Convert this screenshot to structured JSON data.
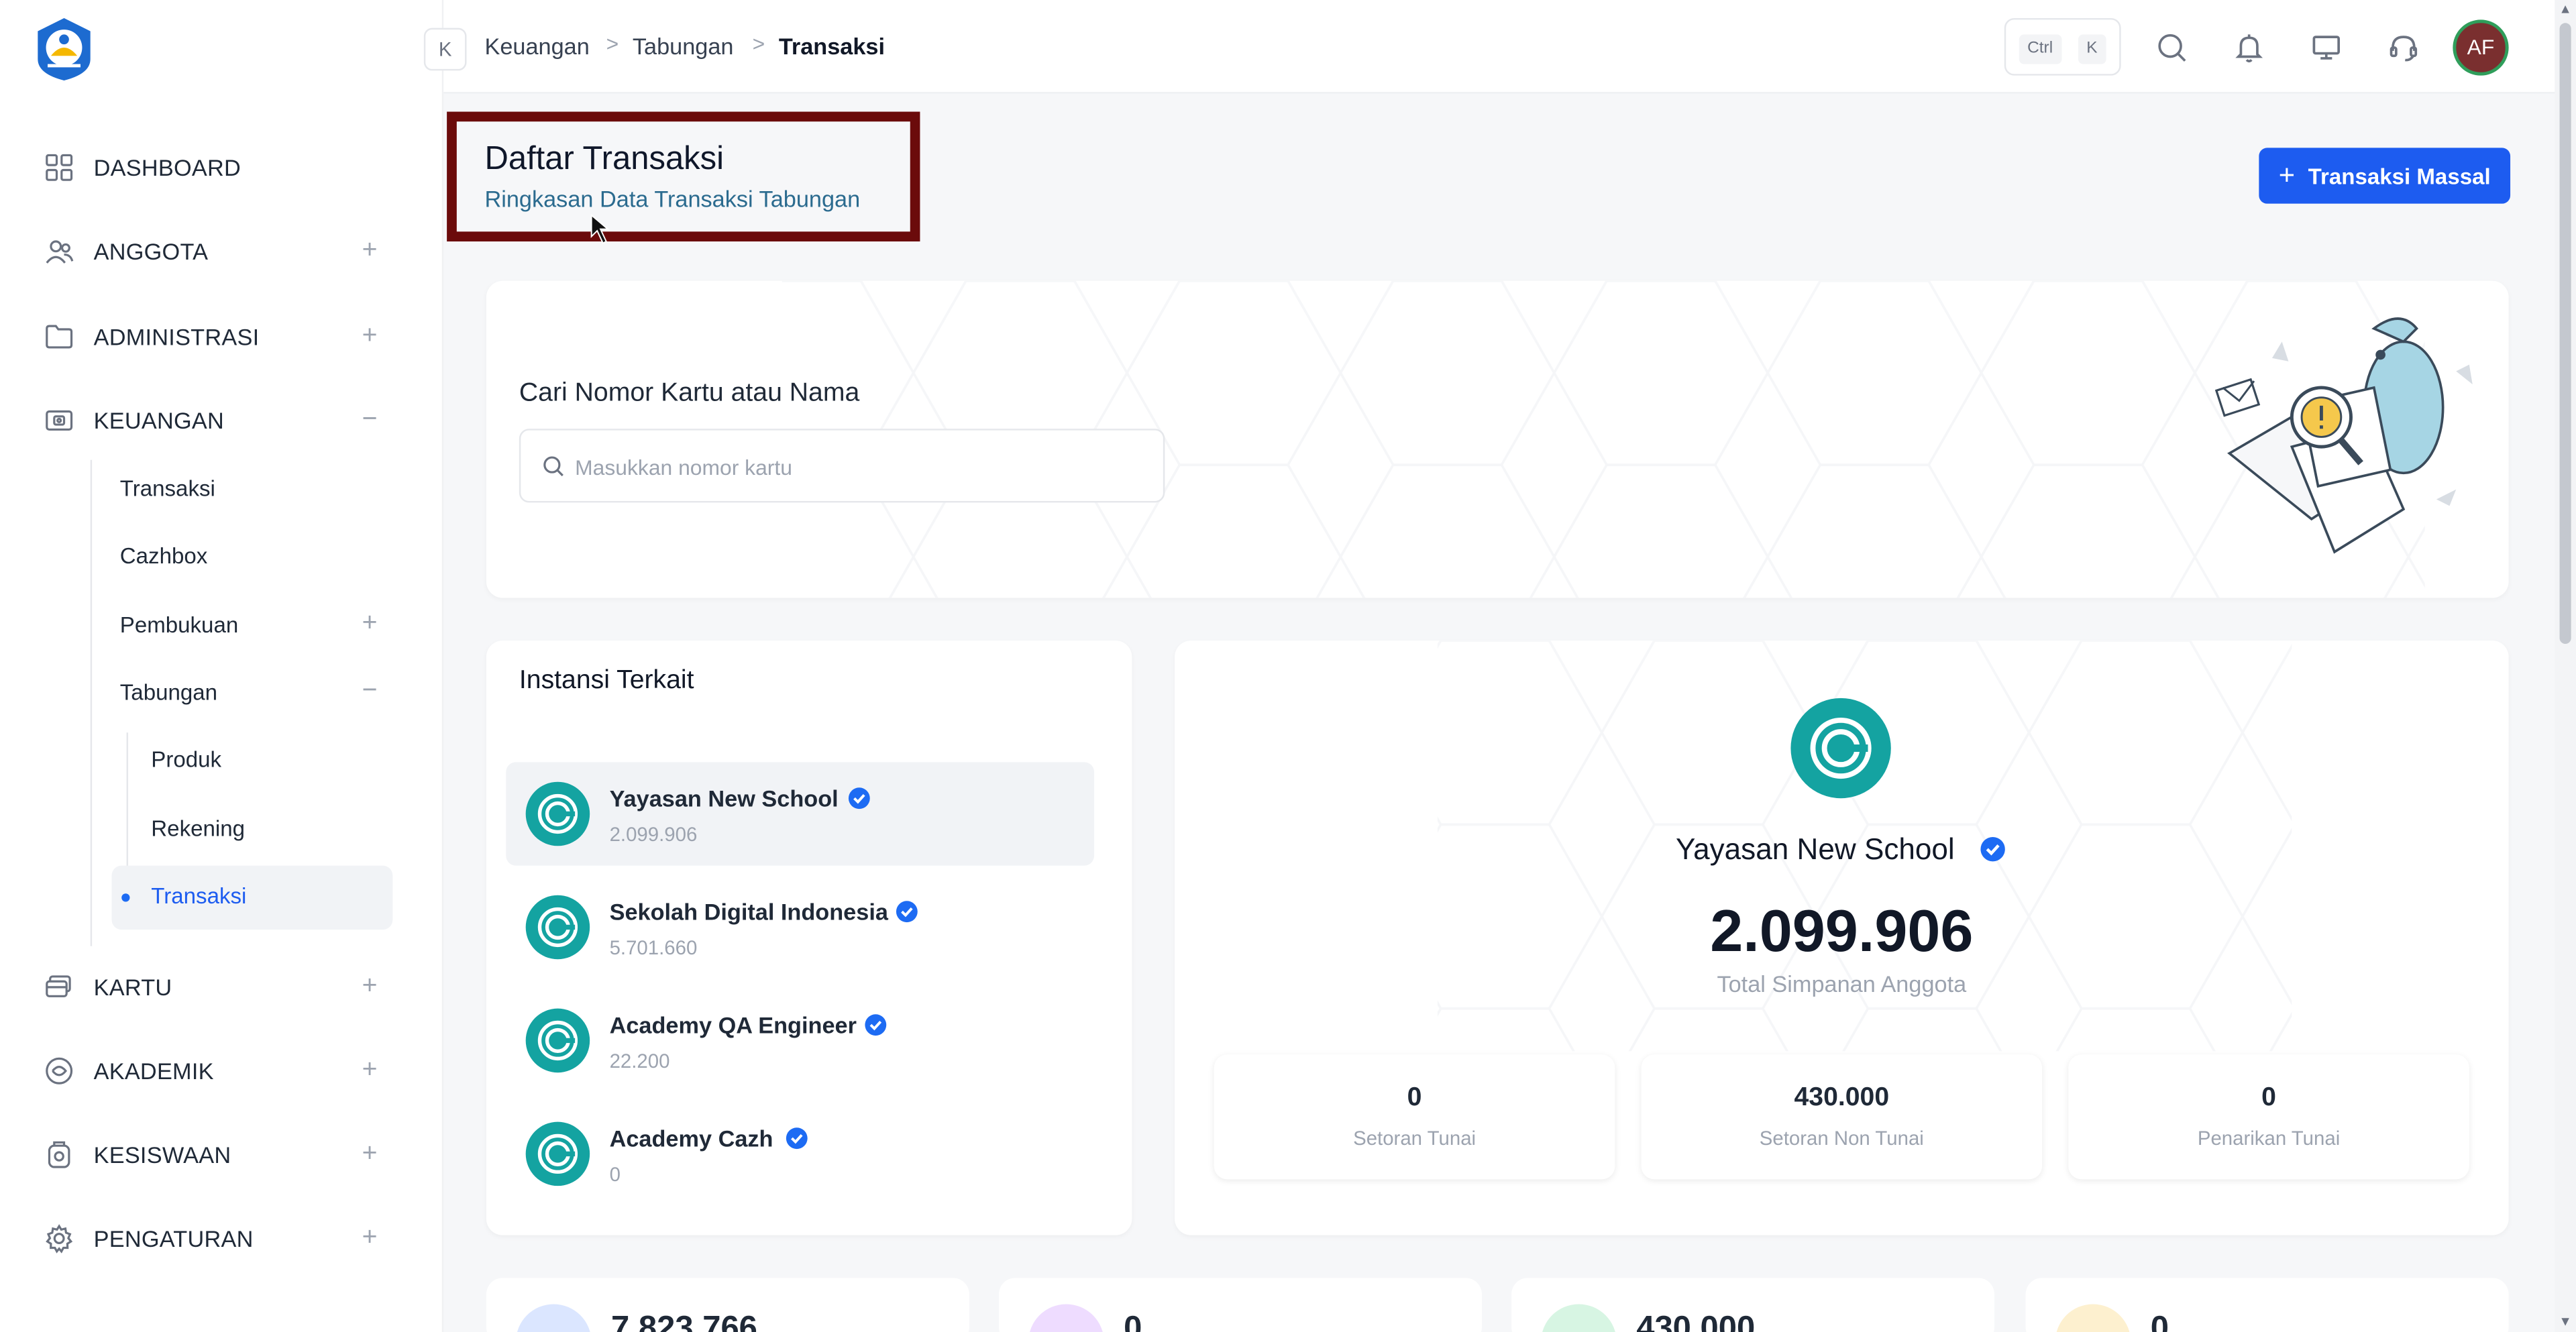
{
  "sidebar": {
    "items": [
      {
        "label": "DASHBOARD",
        "icon": "grid-icon",
        "toggle": ""
      },
      {
        "label": "ANGGOTA",
        "icon": "users-icon",
        "toggle": "+"
      },
      {
        "label": "ADMINISTRASI",
        "icon": "folder-icon",
        "toggle": "+"
      },
      {
        "label": "KEUANGAN",
        "icon": "money-icon",
        "toggle": "−"
      },
      {
        "label": "KARTU",
        "icon": "card-icon",
        "toggle": "+"
      },
      {
        "label": "AKADEMIK",
        "icon": "academic-icon",
        "toggle": "+"
      },
      {
        "label": "KESISWAAN",
        "icon": "student-icon",
        "toggle": "+"
      },
      {
        "label": "PENGATURAN",
        "icon": "gear-icon",
        "toggle": "+"
      }
    ],
    "keuangan_sub": [
      {
        "label": "Transaksi",
        "toggle": ""
      },
      {
        "label": "Cazhbox",
        "toggle": ""
      },
      {
        "label": "Pembukuan",
        "toggle": "+"
      },
      {
        "label": "Tabungan",
        "toggle": "−"
      }
    ],
    "tabungan_sub": [
      "Produk",
      "Rekening",
      "Transaksi"
    ]
  },
  "topbar": {
    "collapse_label": "K",
    "breadcrumb": [
      "Keuangan",
      "Tabungan",
      "Transaksi"
    ],
    "separator": ">",
    "kbd": [
      "Ctrl",
      "K"
    ],
    "avatar_initials": "AF"
  },
  "page": {
    "title": "Daftar Transaksi",
    "subtitle": "Ringkasan Data Transaksi Tabungan",
    "primary_button": "Transaksi Massal",
    "primary_button_icon": "+"
  },
  "search": {
    "label": "Cari Nomor Kartu atau Nama",
    "placeholder": "Masukkan nomor kartu"
  },
  "instansi": {
    "title": "Instansi Terkait",
    "items": [
      {
        "name": "Yayasan New School",
        "value": "2.099.906"
      },
      {
        "name": "Sekolah Digital Indonesia",
        "value": "5.701.660"
      },
      {
        "name": "Academy QA Engineer",
        "value": "22.200"
      },
      {
        "name": "Academy Cazh",
        "value": "0"
      }
    ]
  },
  "detail": {
    "name": "Yayasan New School",
    "total": "2.099.906",
    "total_caption": "Total Simpanan Anggota",
    "stats": [
      {
        "value": "0",
        "caption": "Setoran Tunai"
      },
      {
        "value": "430.000",
        "caption": "Setoran Non Tunai"
      },
      {
        "value": "0",
        "caption": "Penarikan Tunai"
      }
    ]
  },
  "bottom_cards": [
    {
      "value": "7.823.766",
      "color": "#dbe6ff"
    },
    {
      "value": "0",
      "color": "#eedcff"
    },
    {
      "value": "430.000",
      "color": "#d7f5e3"
    },
    {
      "value": "0",
      "color": "#fdf0cf"
    }
  ],
  "colors": {
    "primary": "#1d5cf0",
    "accent_teal": "#14a3a1",
    "highlight_border": "#6b0b0b"
  }
}
